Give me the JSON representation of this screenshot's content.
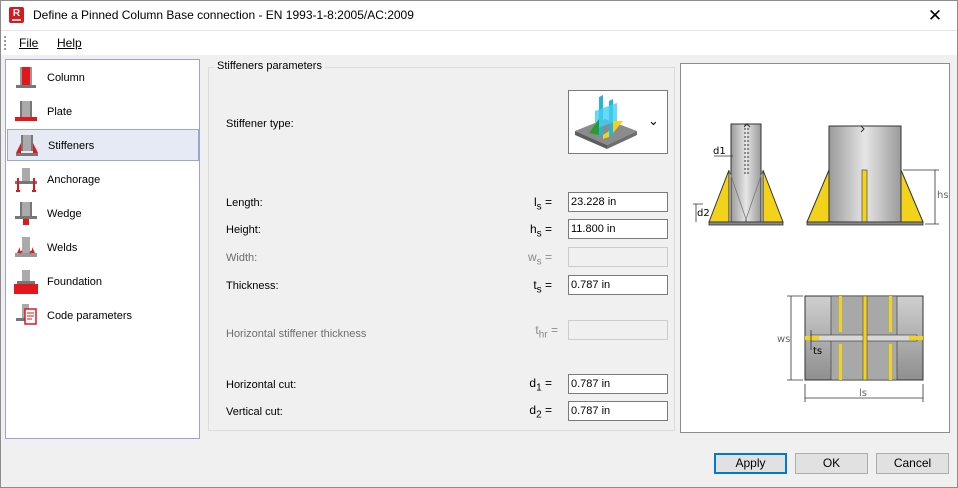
{
  "window": {
    "title": "Define a Pinned Column Base connection - EN 1993-1-8:2005/AC:2009",
    "app_icon_letter": "R",
    "close_glyph": "✕"
  },
  "menu": {
    "file": "File",
    "help": "Help"
  },
  "nav": {
    "selected": "Stiffeners",
    "items": [
      {
        "label": "Column",
        "icon": "column-icon"
      },
      {
        "label": "Plate",
        "icon": "plate-icon"
      },
      {
        "label": "Stiffeners",
        "icon": "stiffeners-icon"
      },
      {
        "label": "Anchorage",
        "icon": "anchorage-icon"
      },
      {
        "label": "Wedge",
        "icon": "wedge-icon"
      },
      {
        "label": "Welds",
        "icon": "welds-icon"
      },
      {
        "label": "Foundation",
        "icon": "foundation-icon"
      },
      {
        "label": "Code parameters",
        "icon": "code-parameters-icon"
      }
    ]
  },
  "form": {
    "group_title": "Stiffeners parameters",
    "stiffener_type_label": "Stiffener type:",
    "length": {
      "label": "Length:",
      "sym": "l",
      "sub": "s",
      "value": "23.228 in"
    },
    "height": {
      "label": "Height:",
      "sym": "h",
      "sub": "s",
      "value": "11.800 in"
    },
    "width": {
      "label": "Width:",
      "sym": "w",
      "sub": "s",
      "value": ""
    },
    "thickness": {
      "label": "Thickness:",
      "sym": "t",
      "sub": "s",
      "value": "0.787 in"
    },
    "hor_thickness": {
      "label": "Horizontal stiffener thickness",
      "sym": "t",
      "sub": "hr",
      "value": ""
    },
    "hor_cut": {
      "label": "Horizontal cut:",
      "sym": "d",
      "sub": "1",
      "value": "0.787 in"
    },
    "vert_cut": {
      "label": "Vertical cut:",
      "sym": "d",
      "sub": "2",
      "value": "0.787 in"
    }
  },
  "preview": {
    "d1": "d1",
    "d2": "d2",
    "hs": "hs",
    "ws": "ws",
    "ts": "ts",
    "ls": "ls"
  },
  "buttons": {
    "apply": "Apply",
    "ok": "OK",
    "cancel": "Cancel"
  },
  "colors": {
    "accent": "#0078d7",
    "steel": "#b8b8b8",
    "stiffener": "#f2d21b",
    "red": "#e3161d"
  }
}
